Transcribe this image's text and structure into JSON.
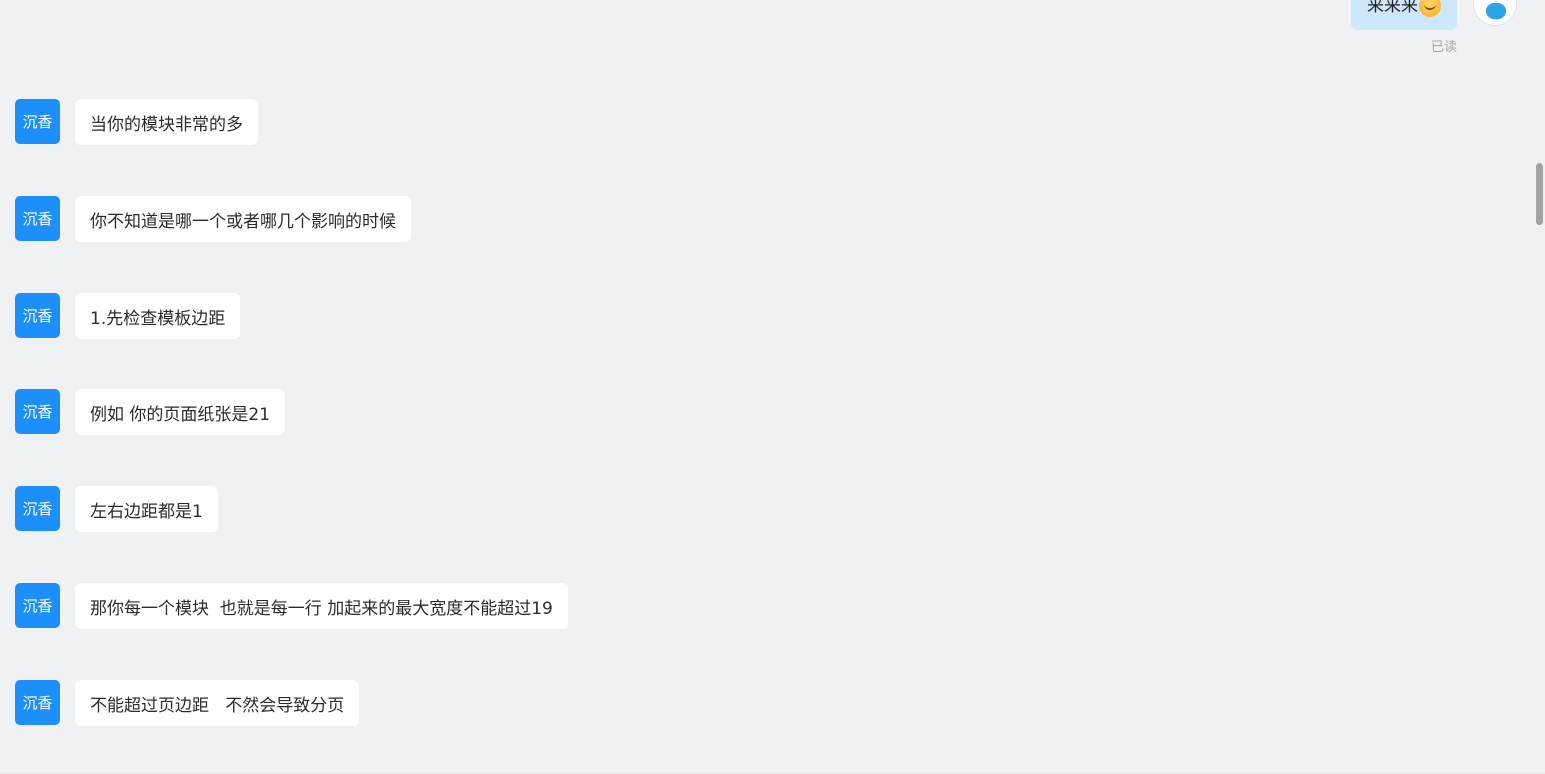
{
  "outgoing": {
    "text": "来来来",
    "emoji": "smiling-face-emoji",
    "status": "已读"
  },
  "messages": [
    {
      "sender": "沉香",
      "text": "当你的模块非常的多"
    },
    {
      "sender": "沉香",
      "text": "你不知道是哪一个或者哪几个影响的时候"
    },
    {
      "sender": "沉香",
      "text": "1.先检查模板边距"
    },
    {
      "sender": "沉香",
      "text": "例如 你的页面纸张是21"
    },
    {
      "sender": "沉香",
      "text": "左右边距都是1"
    },
    {
      "sender": "沉香",
      "text": "那你每一个模块  也就是每一行 加起来的最大宽度不能超过19"
    },
    {
      "sender": "沉香",
      "text": "不能超过页边距   不然会导致分页"
    }
  ],
  "colors": {
    "background": "#f0f1f3",
    "avatar": "#1d8ffb",
    "incoming_bubble": "#ffffff",
    "outgoing_bubble": "#cde7fc"
  }
}
